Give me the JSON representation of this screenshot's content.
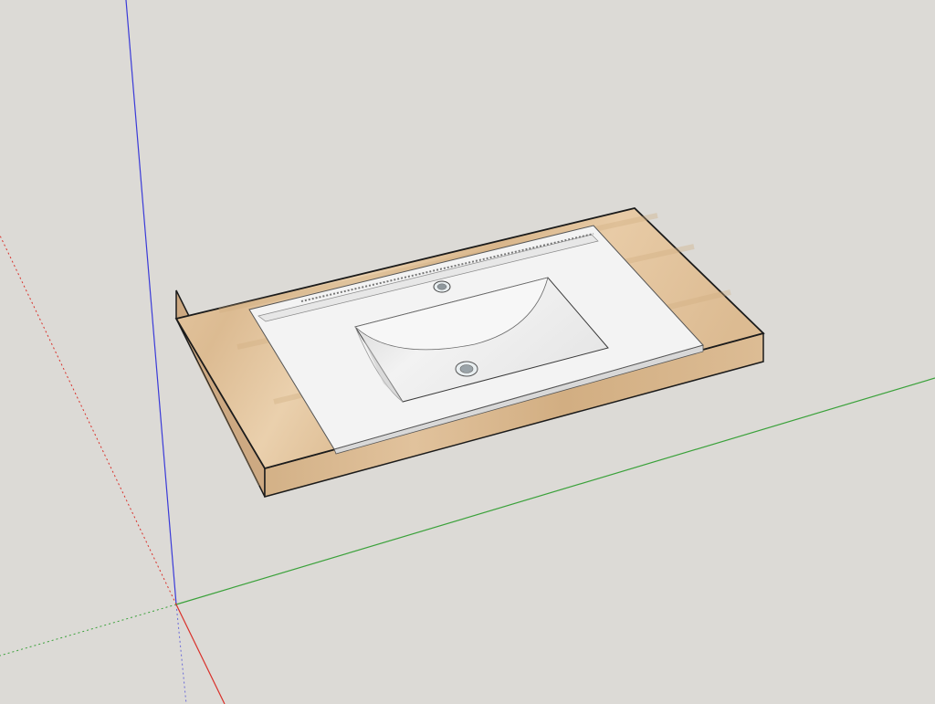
{
  "viewport": {
    "background_color": "#dcdad6"
  },
  "axes": {
    "red_axis_color": "#d9302a",
    "green_axis_color": "#3aa13a",
    "blue_axis_color": "#2a2ad6"
  },
  "model": {
    "countertop": {
      "top_color": "#e4c6a0",
      "front_side_color": "#d9b98f",
      "right_side_color": "#cfae84",
      "edge_color": "#1b1b1b"
    },
    "sink": {
      "rim_color": "#f3f3f3",
      "basin_color": "#e9e9e9",
      "basin_shadow_color": "#c9c9c9",
      "drain_color": "#9aa3a8",
      "faucet_hole_color": "#8f989d"
    }
  }
}
